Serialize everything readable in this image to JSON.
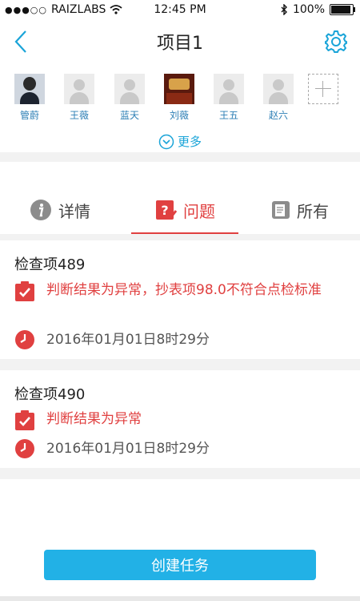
{
  "status_bar": {
    "carrier": "RAIZLABS",
    "time": "12:45 PM",
    "battery": "100%"
  },
  "nav": {
    "title": "项目1"
  },
  "members": [
    {
      "name": "管蔚",
      "avatar": "photo-person"
    },
    {
      "name": "王薇",
      "avatar": "default-avatar"
    },
    {
      "name": "蓝天",
      "avatar": "default-avatar"
    },
    {
      "name": "刘薇",
      "avatar": "photo-scene"
    },
    {
      "name": "王五",
      "avatar": "default-avatar"
    },
    {
      "name": "赵六",
      "avatar": "default-avatar"
    }
  ],
  "more_label": "更多",
  "tabs": [
    {
      "label": "详情",
      "icon": "info-icon"
    },
    {
      "label": "问题",
      "icon": "issue-icon",
      "active": true
    },
    {
      "label": "所有",
      "icon": "list-icon"
    }
  ],
  "issues": [
    {
      "title": "检查项489",
      "result": "判断结果为异常，抄表项98.0不符合点检标准",
      "time": "2016年01月01日8时29分"
    },
    {
      "title": "检查项490",
      "result": "判断结果为异常",
      "time": "2016年01月01日8时29分"
    }
  ],
  "create_button": "创建任务",
  "colors": {
    "accent": "#1aa4d8",
    "alert": "#e04040",
    "button": "#22b1e6"
  }
}
